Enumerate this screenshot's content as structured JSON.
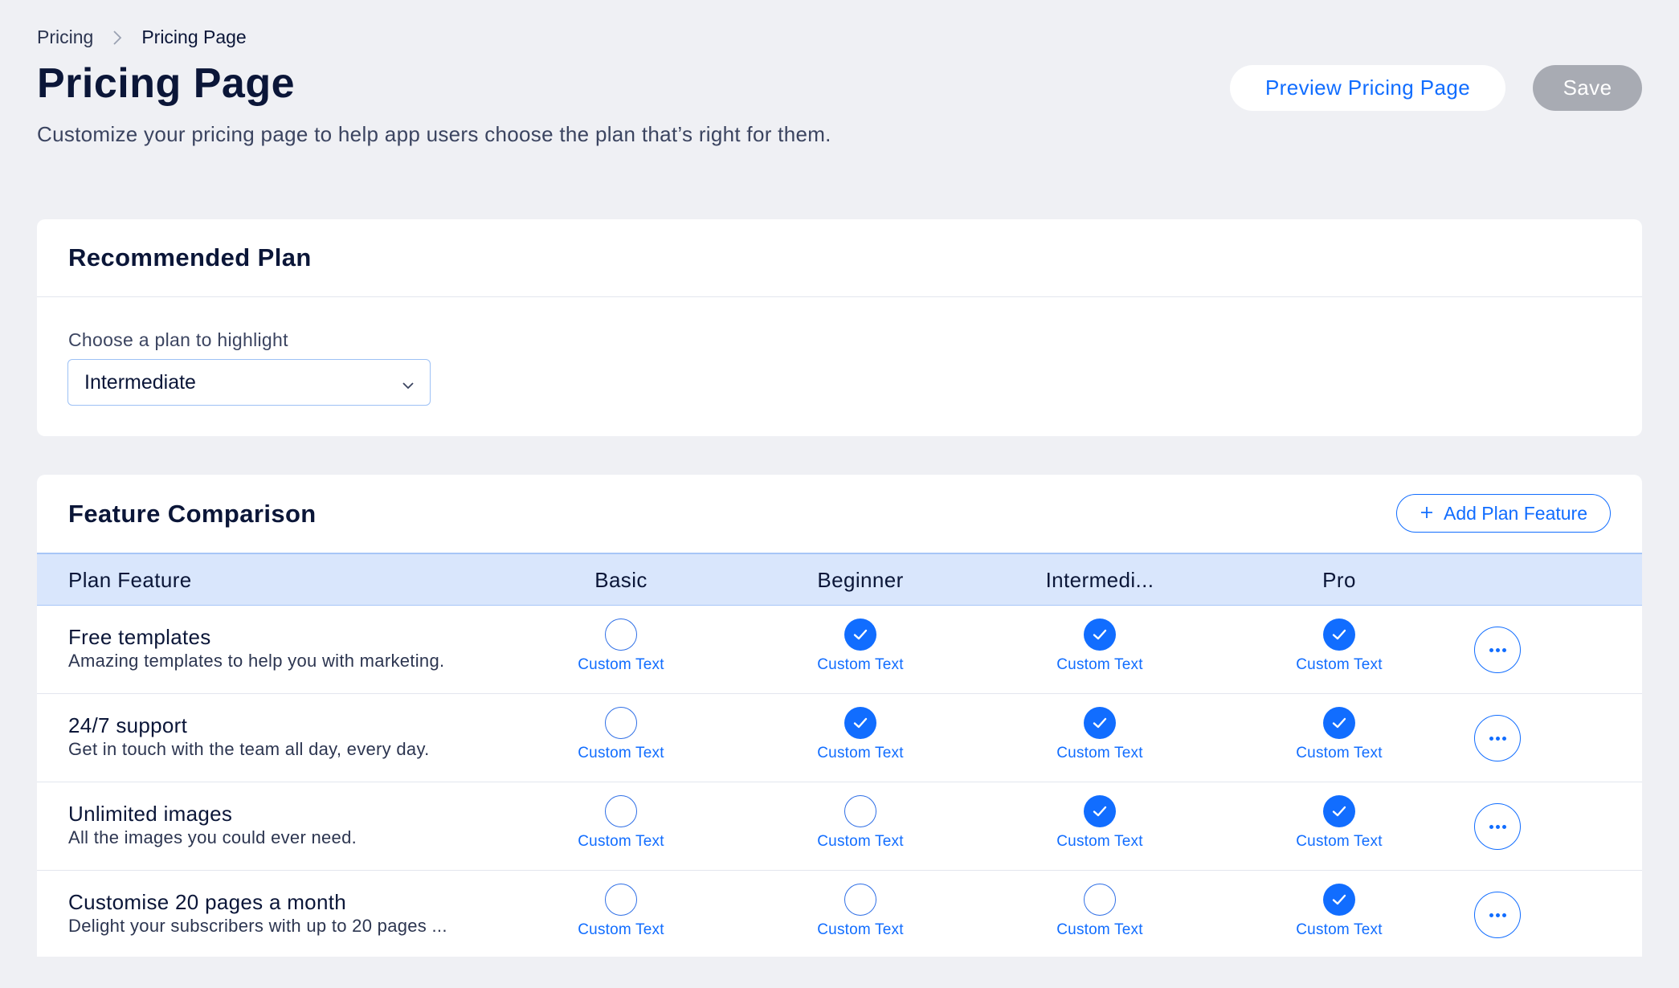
{
  "breadcrumb": {
    "parent": "Pricing",
    "current": "Pricing Page"
  },
  "header": {
    "title": "Pricing Page",
    "subtitle": "Customize your pricing page to help app users choose the plan that’s right for them.",
    "preview_label": "Preview Pricing Page",
    "save_label": "Save"
  },
  "recommended": {
    "title": "Recommended Plan",
    "field_label": "Choose a plan to highlight",
    "selected": "Intermediate"
  },
  "features": {
    "title": "Feature Comparison",
    "add_label": "Add Plan Feature",
    "columns": {
      "feature": "Plan Feature",
      "plans": [
        "Basic",
        "Beginner",
        "Intermedi...",
        "Pro"
      ]
    },
    "rows": [
      {
        "name": "Free templates",
        "desc": "Amazing templates to help you with marketing.",
        "checks": [
          false,
          true,
          true,
          true
        ],
        "cell_texts": [
          "Custom Text",
          "Custom Text",
          "Custom Text",
          "Custom Text"
        ]
      },
      {
        "name": "24/7 support",
        "desc": "Get in touch with the team all day, every day.",
        "checks": [
          false,
          true,
          true,
          true
        ],
        "cell_texts": [
          "Custom Text",
          "Custom Text",
          "Custom Text",
          "Custom Text"
        ]
      },
      {
        "name": "Unlimited images",
        "desc": "All the images you could ever need.",
        "checks": [
          false,
          false,
          true,
          true
        ],
        "cell_texts": [
          "Custom Text",
          "Custom Text",
          "Custom Text",
          "Custom Text"
        ]
      },
      {
        "name": "Customise 20 pages a month",
        "desc": "Delight your subscribers with up to 20 pages ...",
        "checks": [
          false,
          false,
          false,
          true
        ],
        "cell_texts": [
          "Custom Text",
          "Custom Text",
          "Custom Text",
          "Custom Text"
        ]
      }
    ]
  },
  "colors": {
    "accent": "#116dff",
    "background": "#eff0f4",
    "table_header": "#d9e6fc",
    "save_disabled": "#a8abb3"
  },
  "icons": {
    "breadcrumb_separator": "chevron-right-icon",
    "select_toggle": "chevron-down-icon",
    "add": "plus-icon",
    "checked": "check-icon",
    "row_menu": "more-horizontal-icon"
  }
}
